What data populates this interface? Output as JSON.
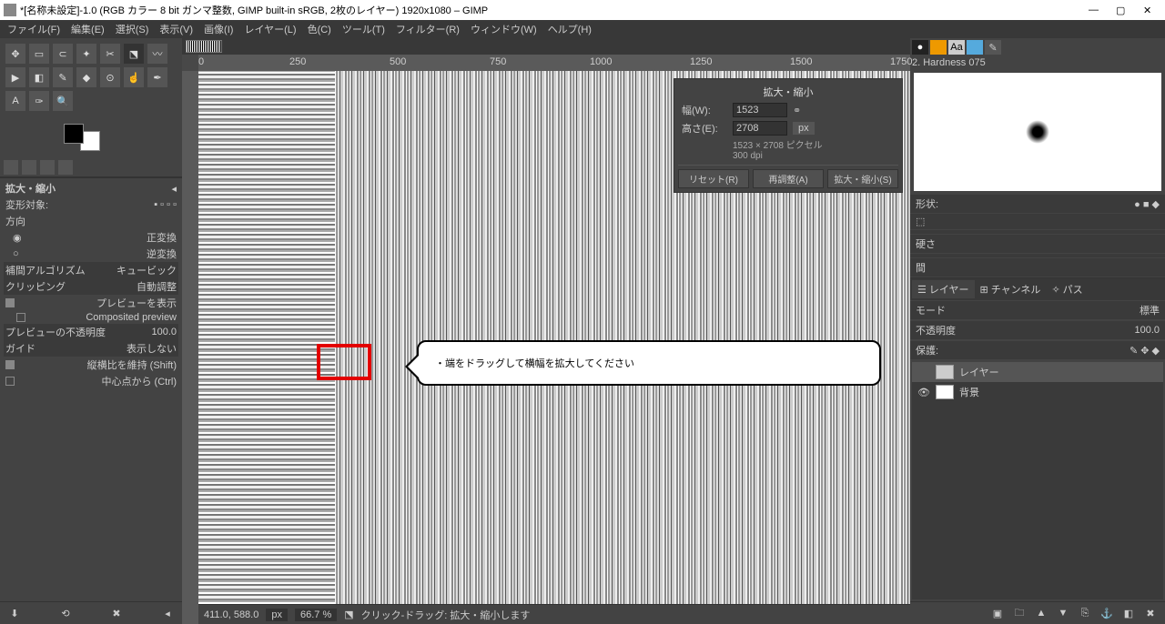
{
  "title": "*[名称未設定]-1.0 (RGB カラー 8 bit ガンマ整数, GIMP built-in sRGB, 2枚のレイヤー) 1920x1080 – GIMP",
  "menu": {
    "file": "ファイル(F)",
    "edit": "編集(E)",
    "select": "選択(S)",
    "view": "表示(V)",
    "image": "画像(I)",
    "layer": "レイヤー(L)",
    "color": "色(C)",
    "tools": "ツール(T)",
    "filters": "フィルター(R)",
    "windows": "ウィンドウ(W)",
    "help": "ヘルプ(H)"
  },
  "tool_opts": {
    "title": "拡大・縮小",
    "transform_target": "変形対象:",
    "direction": "方向",
    "forward": "正変換",
    "backward": "逆変換",
    "interp": "補間アルゴリズム",
    "interp_val": "キュービック",
    "clip": "クリッピング",
    "clip_val": "自動調整",
    "preview": "プレビューを表示",
    "composited": "Composited preview",
    "opacity": "プレビューの不透明度",
    "opacity_val": "100.0",
    "guides": "ガイド",
    "guides_val": "表示しない",
    "aspect": "縦横比を維持 (Shift)",
    "center": "中心点から (Ctrl)"
  },
  "scale_dialog": {
    "title": "拡大・縮小",
    "width_lbl": "幅(W):",
    "width_val": "1523",
    "height_lbl": "高さ(E):",
    "height_val": "2708",
    "unit": "px",
    "info1": "1523 × 2708 ピクセル",
    "info2": "300 dpi",
    "reset": "リセット(R)",
    "readjust": "再調整(A)",
    "scale": "拡大・縮小(S)"
  },
  "callout_text": "・端をドラッグして横幅を拡大してください",
  "brush_title": "2. Hardness 075",
  "brush": {
    "shape": "形状:",
    "hardness": "硬さ",
    "spacing": "間"
  },
  "layer_sec": {
    "tab_layers": "レイヤー",
    "tab_channels": "チャンネル",
    "tab_paths": "パス",
    "mode": "モード",
    "mode_val": "標準",
    "opacity": "不透明度",
    "opacity_val": "100.0",
    "lock": "保護:",
    "layer1": "レイヤー",
    "layer2": "背景"
  },
  "ruler_ticks": [
    "0",
    "250",
    "500",
    "750",
    "1000",
    "1250",
    "1500",
    "1750"
  ],
  "status": {
    "coords": "411.0, 588.0",
    "unit": "px",
    "zoom": "66.7 %",
    "hint": "クリック-ドラッグ: 拡大・縮小します"
  }
}
